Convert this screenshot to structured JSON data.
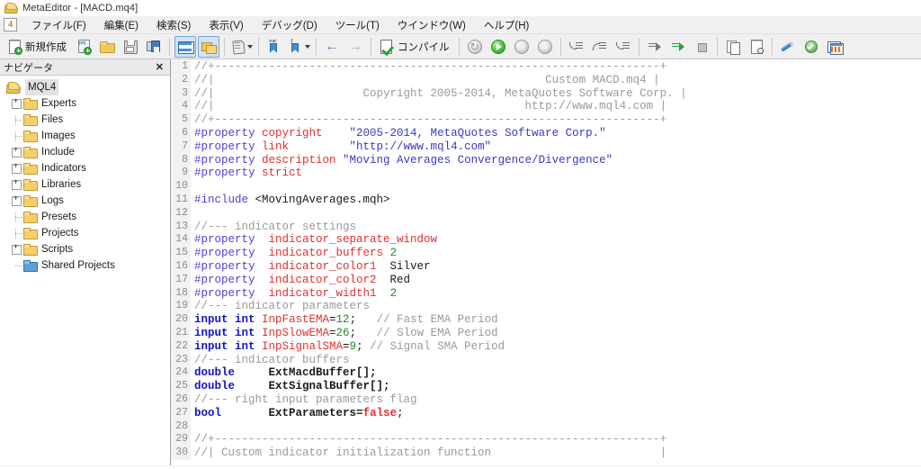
{
  "window": {
    "title": "MetaEditor - [MACD.mq4]",
    "icon": "metaeditor-icon"
  },
  "menubar": {
    "badge": "4",
    "items": [
      {
        "label": "ファイル(F)",
        "name": "menu-file"
      },
      {
        "label": "編集(E)",
        "name": "menu-edit"
      },
      {
        "label": "検索(S)",
        "name": "menu-search"
      },
      {
        "label": "表示(V)",
        "name": "menu-view"
      },
      {
        "label": "デバッグ(D)",
        "name": "menu-debug"
      },
      {
        "label": "ツール(T)",
        "name": "menu-tools"
      },
      {
        "label": "ウインドウ(W)",
        "name": "menu-window"
      },
      {
        "label": "ヘルプ(H)",
        "name": "menu-help"
      }
    ]
  },
  "toolbar": {
    "new_label": "新規作成",
    "compile_label": "コンパイル",
    "buttons": [
      "new-document",
      "new-project",
      "open-folder",
      "save",
      "save-all",
      "navigator-toggle",
      "toolbox-toggle",
      "properties",
      "bookmark-var",
      "bookmark-function",
      "navigate-back",
      "navigate-forward",
      "compile",
      "restart-debug",
      "start-debug",
      "pause-debug",
      "stop-debug",
      "step-into",
      "step-over",
      "step-out",
      "run-to-cursor",
      "run-to-cursor-active",
      "stop-script",
      "copy-to-clipboard",
      "find-in-files",
      "style-formatter",
      "metaquotes-validate",
      "open-charts"
    ]
  },
  "navigator": {
    "title": "ナビゲータ",
    "close": "✕",
    "root": {
      "label": "MQL4",
      "selected": true
    },
    "items": [
      {
        "label": "Experts",
        "expandable": true,
        "color": "yellow"
      },
      {
        "label": "Files",
        "expandable": false,
        "color": "yellow"
      },
      {
        "label": "Images",
        "expandable": false,
        "color": "yellow"
      },
      {
        "label": "Include",
        "expandable": true,
        "color": "yellow"
      },
      {
        "label": "Indicators",
        "expandable": true,
        "color": "yellow"
      },
      {
        "label": "Libraries",
        "expandable": true,
        "color": "yellow"
      },
      {
        "label": "Logs",
        "expandable": true,
        "color": "yellow"
      },
      {
        "label": "Presets",
        "expandable": false,
        "color": "yellow"
      },
      {
        "label": "Projects",
        "expandable": false,
        "color": "yellow"
      },
      {
        "label": "Scripts",
        "expandable": true,
        "color": "yellow"
      },
      {
        "label": "Shared Projects",
        "expandable": false,
        "color": "blue"
      }
    ]
  },
  "editor": {
    "filename": "MACD.mq4",
    "lines": [
      {
        "n": 1,
        "tokens": [
          {
            "t": "//+------------------------------------------------------------------+",
            "c": "c-comment"
          }
        ]
      },
      {
        "n": 2,
        "tokens": [
          {
            "t": "//|                                                 Custom MACD.mq4 |",
            "c": "c-comment"
          }
        ]
      },
      {
        "n": 3,
        "tokens": [
          {
            "t": "//|                      Copyright 2005-2014, MetaQuotes Software Corp. |",
            "c": "c-comment"
          }
        ]
      },
      {
        "n": 4,
        "tokens": [
          {
            "t": "//|                                              http://www.mql4.com |",
            "c": "c-comment"
          }
        ]
      },
      {
        "n": 5,
        "tokens": [
          {
            "t": "//+------------------------------------------------------------------+",
            "c": "c-comment"
          }
        ]
      },
      {
        "n": 6,
        "tokens": [
          {
            "t": "#property ",
            "c": "c-pre"
          },
          {
            "t": "copyright",
            "c": "c-prop"
          },
          {
            "t": "    ",
            "c": "c-plain"
          },
          {
            "t": "\"2005-2014, MetaQuotes Software Corp.\"",
            "c": "c-str"
          }
        ]
      },
      {
        "n": 7,
        "tokens": [
          {
            "t": "#property ",
            "c": "c-pre"
          },
          {
            "t": "link",
            "c": "c-prop"
          },
          {
            "t": "         ",
            "c": "c-plain"
          },
          {
            "t": "\"http://www.mql4.com\"",
            "c": "c-str"
          }
        ]
      },
      {
        "n": 8,
        "tokens": [
          {
            "t": "#property ",
            "c": "c-pre"
          },
          {
            "t": "description",
            "c": "c-prop"
          },
          {
            "t": " ",
            "c": "c-plain"
          },
          {
            "t": "\"Moving Averages Convergence/Divergence\"",
            "c": "c-str"
          }
        ]
      },
      {
        "n": 9,
        "tokens": [
          {
            "t": "#property ",
            "c": "c-pre"
          },
          {
            "t": "strict",
            "c": "c-prop"
          }
        ]
      },
      {
        "n": 10,
        "tokens": [
          {
            "t": "",
            "c": "c-plain"
          }
        ]
      },
      {
        "n": 11,
        "tokens": [
          {
            "t": "#include ",
            "c": "c-pre"
          },
          {
            "t": "<MovingAverages.mqh>",
            "c": "c-plain"
          }
        ]
      },
      {
        "n": 12,
        "tokens": [
          {
            "t": "",
            "c": "c-plain"
          }
        ]
      },
      {
        "n": 13,
        "tokens": [
          {
            "t": "//--- indicator settings",
            "c": "c-comment"
          }
        ]
      },
      {
        "n": 14,
        "tokens": [
          {
            "t": "#property ",
            "c": "c-pre"
          },
          {
            "t": " indicator_separate_window",
            "c": "c-prop"
          }
        ]
      },
      {
        "n": 15,
        "tokens": [
          {
            "t": "#property ",
            "c": "c-pre"
          },
          {
            "t": " indicator_buffers",
            "c": "c-prop"
          },
          {
            "t": " ",
            "c": "c-plain"
          },
          {
            "t": "2",
            "c": "c-num"
          }
        ]
      },
      {
        "n": 16,
        "tokens": [
          {
            "t": "#property ",
            "c": "c-pre"
          },
          {
            "t": " indicator_color1",
            "c": "c-prop"
          },
          {
            "t": "  Silver",
            "c": "c-plain"
          }
        ]
      },
      {
        "n": 17,
        "tokens": [
          {
            "t": "#property ",
            "c": "c-pre"
          },
          {
            "t": " indicator_color2",
            "c": "c-prop"
          },
          {
            "t": "  Red",
            "c": "c-plain"
          }
        ]
      },
      {
        "n": 18,
        "tokens": [
          {
            "t": "#property ",
            "c": "c-pre"
          },
          {
            "t": " indicator_width1",
            "c": "c-prop"
          },
          {
            "t": "  ",
            "c": "c-plain"
          },
          {
            "t": "2",
            "c": "c-num"
          }
        ]
      },
      {
        "n": 19,
        "tokens": [
          {
            "t": "//--- indicator parameters",
            "c": "c-comment"
          }
        ]
      },
      {
        "n": 20,
        "tokens": [
          {
            "t": "input int ",
            "c": "c-kw"
          },
          {
            "t": "InpFastEMA",
            "c": "c-prop"
          },
          {
            "t": "=",
            "c": "c-plain"
          },
          {
            "t": "12",
            "c": "c-num"
          },
          {
            "t": ";",
            "c": "c-plain"
          },
          {
            "t": "   ",
            "c": "c-plain"
          },
          {
            "t": "// Fast EMA Period",
            "c": "c-comment"
          }
        ]
      },
      {
        "n": 21,
        "tokens": [
          {
            "t": "input int ",
            "c": "c-kw"
          },
          {
            "t": "InpSlowEMA",
            "c": "c-prop"
          },
          {
            "t": "=",
            "c": "c-plain"
          },
          {
            "t": "26",
            "c": "c-num"
          },
          {
            "t": ";",
            "c": "c-plain"
          },
          {
            "t": "   ",
            "c": "c-plain"
          },
          {
            "t": "// Slow EMA Period",
            "c": "c-comment"
          }
        ]
      },
      {
        "n": 22,
        "tokens": [
          {
            "t": "input int ",
            "c": "c-kw"
          },
          {
            "t": "InpSignalSMA",
            "c": "c-prop"
          },
          {
            "t": "=",
            "c": "c-plain"
          },
          {
            "t": "9",
            "c": "c-num"
          },
          {
            "t": ";",
            "c": "c-plain"
          },
          {
            "t": " ",
            "c": "c-plain"
          },
          {
            "t": "// Signal SMA Period",
            "c": "c-comment"
          }
        ]
      },
      {
        "n": 23,
        "tokens": [
          {
            "t": "//--- indicator buffers",
            "c": "c-comment"
          }
        ]
      },
      {
        "n": 24,
        "tokens": [
          {
            "t": "double",
            "c": "c-kw"
          },
          {
            "t": "     ",
            "c": "c-plain"
          },
          {
            "t": "ExtMacdBuffer[];",
            "c": "c-ident"
          }
        ]
      },
      {
        "n": 25,
        "tokens": [
          {
            "t": "double",
            "c": "c-kw"
          },
          {
            "t": "     ",
            "c": "c-plain"
          },
          {
            "t": "ExtSignalBuffer[];",
            "c": "c-ident"
          }
        ]
      },
      {
        "n": 26,
        "tokens": [
          {
            "t": "//--- right input parameters flag",
            "c": "c-comment"
          }
        ]
      },
      {
        "n": 27,
        "tokens": [
          {
            "t": "bool",
            "c": "c-kw"
          },
          {
            "t": "       ",
            "c": "c-plain"
          },
          {
            "t": "ExtParameters=",
            "c": "c-ident"
          },
          {
            "t": "false",
            "c": "c-false"
          },
          {
            "t": ";",
            "c": "c-plain"
          }
        ]
      },
      {
        "n": 28,
        "tokens": [
          {
            "t": "",
            "c": "c-plain"
          }
        ]
      },
      {
        "n": 29,
        "tokens": [
          {
            "t": "//+------------------------------------------------------------------+",
            "c": "c-comment"
          }
        ]
      },
      {
        "n": 30,
        "tokens": [
          {
            "t": "//| Custom indicator initialization function                         |",
            "c": "c-comment"
          }
        ]
      }
    ]
  },
  "colors": {
    "accent": "#4a90d9",
    "toolbar_bg": "#f0f0f0",
    "gutter_bg": "#f2f2f2",
    "comment": "#9a9a9a",
    "preprocessor": "#5b3bd6",
    "property": "#e03030",
    "string": "#3838c8",
    "keyword": "#1414c8",
    "number": "#228b22"
  }
}
